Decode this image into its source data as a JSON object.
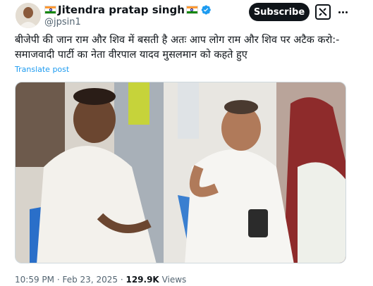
{
  "author": {
    "name": "Jitendra pratap singh",
    "handle": "@jpsin1",
    "flag_icon": "india-flag-icon",
    "verified_icon": "verified-badge-icon",
    "verified_color": "#1d9bf0"
  },
  "header": {
    "subscribe_label": "Subscribe",
    "grok_icon": "grok-icon",
    "more_icon": "more-options-icon"
  },
  "tweet": {
    "text_line1": "बीजेपी की जान राम और शिव में बसती है अतः आप लोग राम और शिव पर अटैक करो:-",
    "text_line2": "समाजवादी पार्टी का नेता वीरपाल यादव मुसलमान को कहते हुए",
    "translate_label": "Translate post"
  },
  "meta": {
    "time": "10:59 PM",
    "separator": "·",
    "date": "Feb 23, 2025",
    "views_count": "129.9K",
    "views_label": "Views"
  },
  "colors": {
    "text": "#0f1419",
    "secondary": "#536471",
    "link": "#1d9bf0"
  }
}
